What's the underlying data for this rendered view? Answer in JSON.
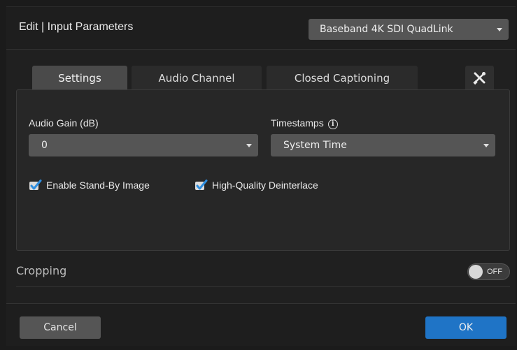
{
  "dialog": {
    "title": "Edit | Input Parameters",
    "source": {
      "selected": "Baseband 4K SDI QuadLink"
    }
  },
  "tabs": [
    {
      "label": "Settings",
      "active": true
    },
    {
      "label": "Audio Channel",
      "active": false
    },
    {
      "label": "Closed Captioning",
      "active": false
    }
  ],
  "tools": {
    "icon": "wrench-screwdriver-icon"
  },
  "settings": {
    "audio_gain": {
      "label": "Audio Gain (dB)",
      "value": "0"
    },
    "timestamps": {
      "label": "Timestamps",
      "value": "System Time",
      "info_icon": "info-icon"
    },
    "enable_standby": {
      "label": "Enable Stand-By Image",
      "checked": true
    },
    "hq_deinterlace": {
      "label": "High-Quality Deinterlace",
      "checked": true
    }
  },
  "cropping": {
    "label": "Cropping",
    "toggle_state": "OFF"
  },
  "footer": {
    "cancel_label": "Cancel",
    "ok_label": "OK"
  },
  "colors": {
    "accent": "#1f74c6",
    "checkmark": "#2e8ee0",
    "background": "#202020"
  }
}
